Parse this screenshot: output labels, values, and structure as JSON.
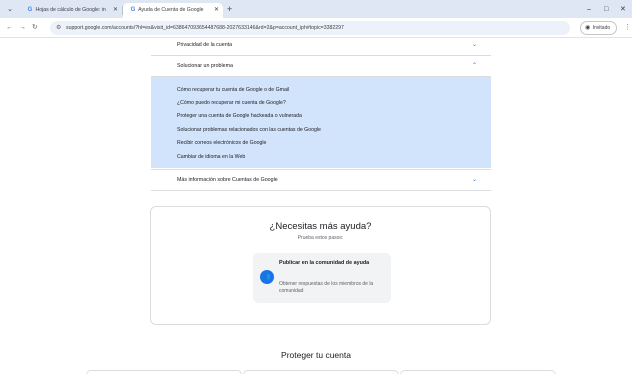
{
  "browser": {
    "tabs": [
      {
        "favicon": "G",
        "title": "Hojas de cálculo de Google: in",
        "active": false
      },
      {
        "favicon": "G",
        "title": "Ayuda de Cuenta de Google",
        "active": true
      }
    ],
    "new_tab_symbol": "+",
    "window_controls": [
      "–",
      "□",
      "✕"
    ],
    "url": "support.google.com/accounts/?hl=es&visit_id=638647093654487688-2027633146&rd=2&p=account_iph#topic=3382297",
    "profile_label": "Invitado"
  },
  "accordion": {
    "privacy_label": "Privacidad de la cuenta",
    "solve_label": "Solucionar un problema",
    "solve_links": [
      "Cómo recuperar tu cuenta de Google o de Gmail",
      "¿Cómo puedo recuperar mi cuenta de Google?",
      "Proteger una cuenta de Google hackeada o vulnerada",
      "Solucionar problemas relacionados con las cuentas de Google",
      "Recibir correos electrónicos de Google",
      "Cambiar de idioma en la Web"
    ],
    "more_label": "Más información sobre Cuentas de Google"
  },
  "help": {
    "title": "¿Necesitas más ayuda?",
    "subtitle": "Prueba estos pasos:",
    "option": {
      "title": "Publicar en la comunidad de ayuda",
      "description": "Obtener respuestas de los miembros de la comunidad"
    }
  },
  "protect_title": "Proteger tu cuenta",
  "colors": {
    "accent": "#1a73e8",
    "panel": "#d2e3fc",
    "tabstrip": "#dfe7f5"
  }
}
